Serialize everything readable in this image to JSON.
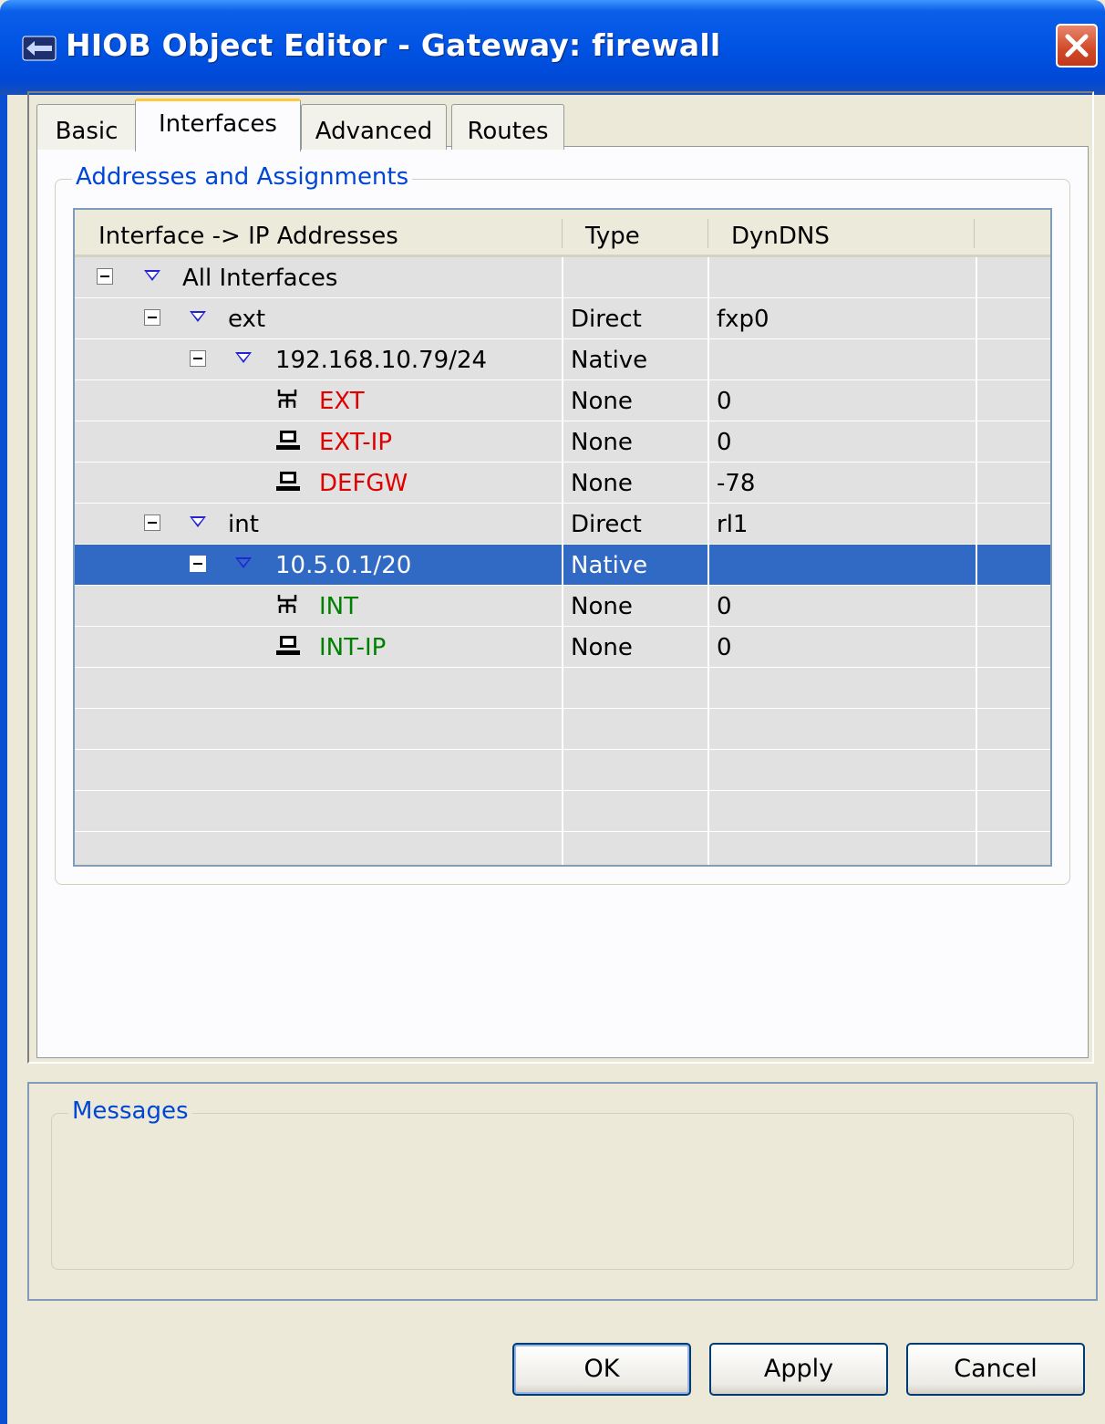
{
  "window": {
    "title": "HIOB Object Editor - Gateway: firewall"
  },
  "tabs": [
    "Basic",
    "Interfaces",
    "Advanced",
    "Routes"
  ],
  "active_tab": "Interfaces",
  "group_title": "Addresses and Assignments",
  "table": {
    "columns": [
      "Interface -> IP Addresses",
      "Type",
      "DynDNS"
    ],
    "rows": [
      {
        "label": "All Interfaces",
        "type": "",
        "dyndns": ""
      },
      {
        "label": "ext",
        "type": "Direct",
        "dyndns": "fxp0"
      },
      {
        "label": "192.168.10.79/24",
        "type": "Native",
        "dyndns": ""
      },
      {
        "label": "EXT",
        "type": "None",
        "dyndns": "0"
      },
      {
        "label": "EXT-IP",
        "type": "None",
        "dyndns": "0"
      },
      {
        "label": "DEFGW",
        "type": "None",
        "dyndns": "-78"
      },
      {
        "label": "int",
        "type": "Direct",
        "dyndns": "rl1"
      },
      {
        "label": "10.5.0.1/20",
        "type": "Native",
        "dyndns": ""
      },
      {
        "label": "INT",
        "type": "None",
        "dyndns": "0"
      },
      {
        "label": "INT-IP",
        "type": "None",
        "dyndns": "0"
      }
    ]
  },
  "messages_title": "Messages",
  "buttons": {
    "ok": "OK",
    "apply": "Apply",
    "cancel": "Cancel"
  },
  "colors": {
    "selection": "#316ac5",
    "ext_objects": "#e00000",
    "int_objects": "#008000",
    "group_title": "#0046d5"
  }
}
